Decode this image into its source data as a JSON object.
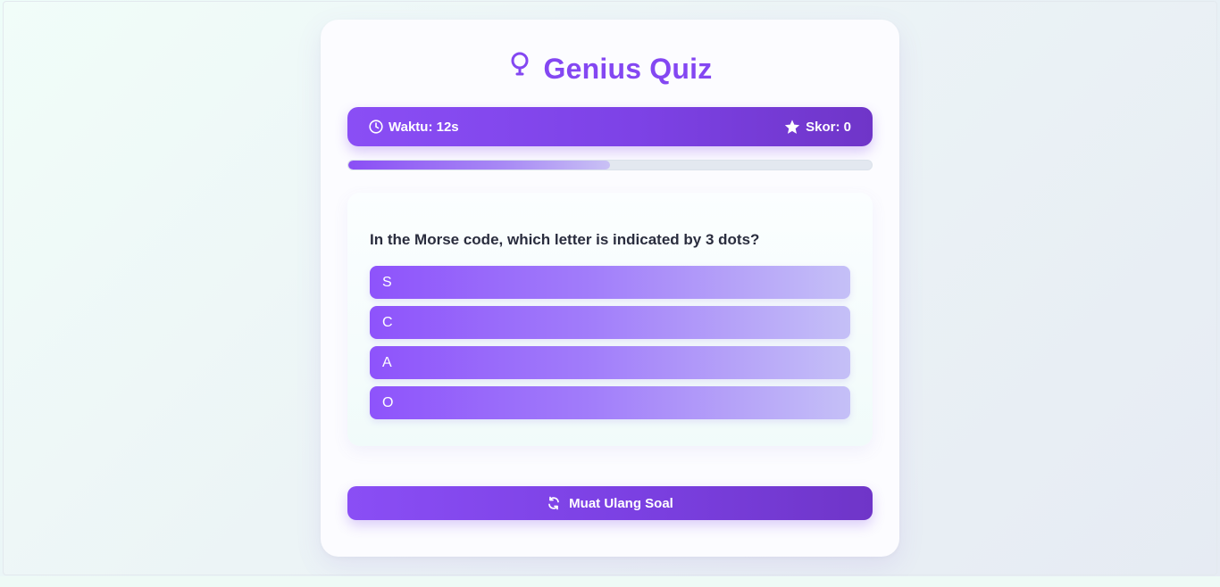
{
  "app": {
    "title": "Genius Quiz",
    "title_icon": "lightbulb-icon"
  },
  "status": {
    "time_label": "Waktu: 12s",
    "time_icon": "clock-icon",
    "score_label": "Skor: 0",
    "score_icon": "star-icon"
  },
  "progress": {
    "fraction": 0.5
  },
  "question": {
    "text": "In the Morse code, which letter is indicated by 3 dots?",
    "options": [
      {
        "label": "S"
      },
      {
        "label": "C"
      },
      {
        "label": "A"
      },
      {
        "label": "O"
      }
    ]
  },
  "actions": {
    "reload_label": "Muat Ulang Soal",
    "reload_icon": "refresh-icon"
  },
  "colors": {
    "accent": "#8447f2",
    "accent_dark": "#6f35c8",
    "option_start": "#8e53fb",
    "option_end": "#c5c0f7"
  }
}
